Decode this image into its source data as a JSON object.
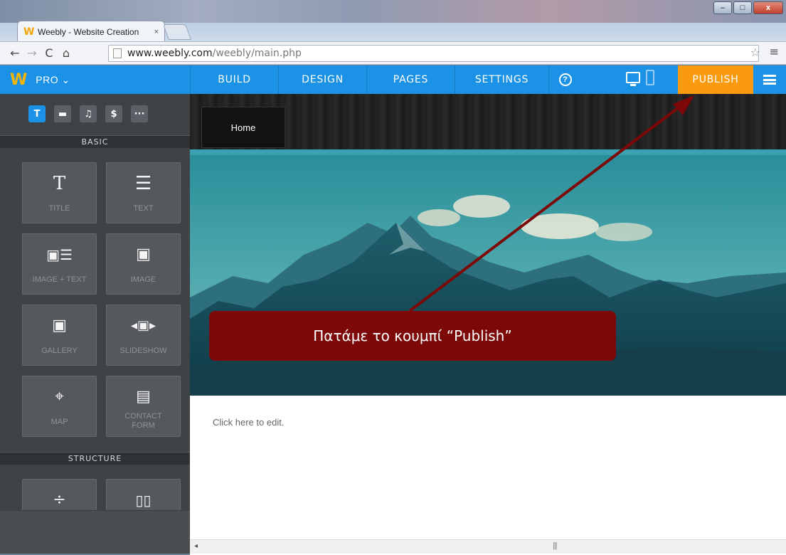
{
  "browser": {
    "tab_title": "Weebly - Website Creation",
    "tab_close": "×",
    "favicon": "W",
    "url_domain": "www.weebly.com",
    "url_path": "/weebly/main.php",
    "win_minimize": "–",
    "win_maximize": "□",
    "win_close": "x"
  },
  "header": {
    "logo": "W",
    "plan": "PRO ⌄",
    "nav": [
      "BUILD",
      "DESIGN",
      "PAGES",
      "SETTINGS"
    ],
    "help": "?",
    "publish": "PUBLISH"
  },
  "sidebar": {
    "tabs": [
      "T",
      "▬",
      "♫",
      "$",
      "···"
    ],
    "sections": [
      "BASIC",
      "STRUCTURE"
    ],
    "tiles": [
      {
        "icon": "T",
        "label": "TITLE"
      },
      {
        "icon": "☰",
        "label": "TEXT"
      },
      {
        "icon": "▣☰",
        "label": "IMAGE + TEXT"
      },
      {
        "icon": "▣",
        "label": "IMAGE"
      },
      {
        "icon": "▣",
        "label": "GALLERY"
      },
      {
        "icon": "◂▣▸",
        "label": "SLIDESHOW"
      },
      {
        "icon": "⌖",
        "label": "MAP"
      },
      {
        "icon": "▤",
        "label": "CONTACT FORM"
      },
      {
        "icon": "÷",
        "label": ""
      },
      {
        "icon": "▯▯",
        "label": ""
      }
    ]
  },
  "canvas": {
    "nav_home": "Home",
    "edit_text": "Click here to edit."
  },
  "annotation": {
    "callout_text": "Πατάμε το κουμπί “Publish”",
    "color": "#7c0808"
  },
  "colors": {
    "weebly_blue": "#1b92e6",
    "publish_orange": "#fa9a0f",
    "sidebar_dark": "#3f4346"
  }
}
